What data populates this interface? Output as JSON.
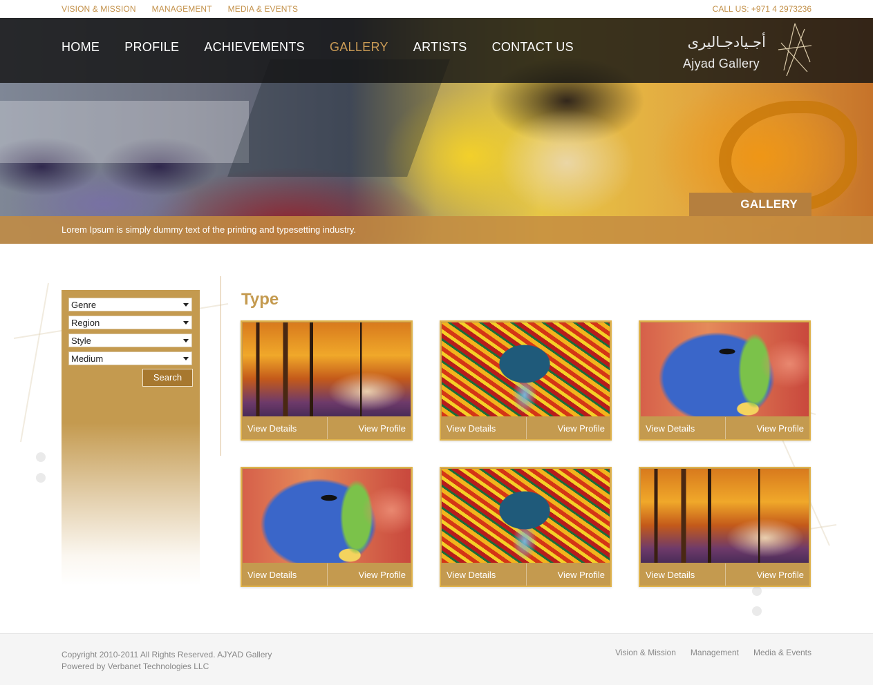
{
  "topbar": {
    "links": [
      "VISION & MISSION",
      "MANAGEMENT",
      "MEDIA & EVENTS"
    ],
    "phone": "CALL US: +971 4 2973236"
  },
  "nav": {
    "items": [
      "HOME",
      "PROFILE",
      "ACHIEVEMENTS",
      "GALLERY",
      "ARTISTS",
      "CONTACT US"
    ],
    "active": "GALLERY"
  },
  "logo": {
    "arabic": "أجـيادجـاليرى",
    "english": "Ajyad Gallery"
  },
  "hero": {
    "section_tag": "GALLERY",
    "caption": "Lorem Ipsum is simply dummy text of the printing and typesetting industry."
  },
  "filters": {
    "selects": [
      "Genre",
      "Region",
      "Style",
      "Medium"
    ],
    "search_label": "Search"
  },
  "content": {
    "title": "Type",
    "cards": [
      {
        "art": "autumn",
        "details": "View Details",
        "profile": "View Profile"
      },
      {
        "art": "umbrella",
        "details": "View Details",
        "profile": "View Profile"
      },
      {
        "art": "elephant",
        "details": "View Details",
        "profile": "View Profile"
      },
      {
        "art": "elephant",
        "details": "View Details",
        "profile": "View Profile"
      },
      {
        "art": "umbrella",
        "details": "View Details",
        "profile": "View Profile"
      },
      {
        "art": "autumn",
        "details": "View Details",
        "profile": "View Profile"
      }
    ]
  },
  "footer": {
    "copyright": "Copyright 2010-2011 All Rights Reserved. AJYAD Gallery",
    "powered": "Powered by Verbanet Technologies LLC",
    "links": [
      "Vision & Mission",
      "Management",
      "Media & Events"
    ]
  },
  "colors": {
    "accent": "#c49a4f",
    "active_nav": "#c99a55",
    "nav_bg": "#1a1a1a"
  }
}
